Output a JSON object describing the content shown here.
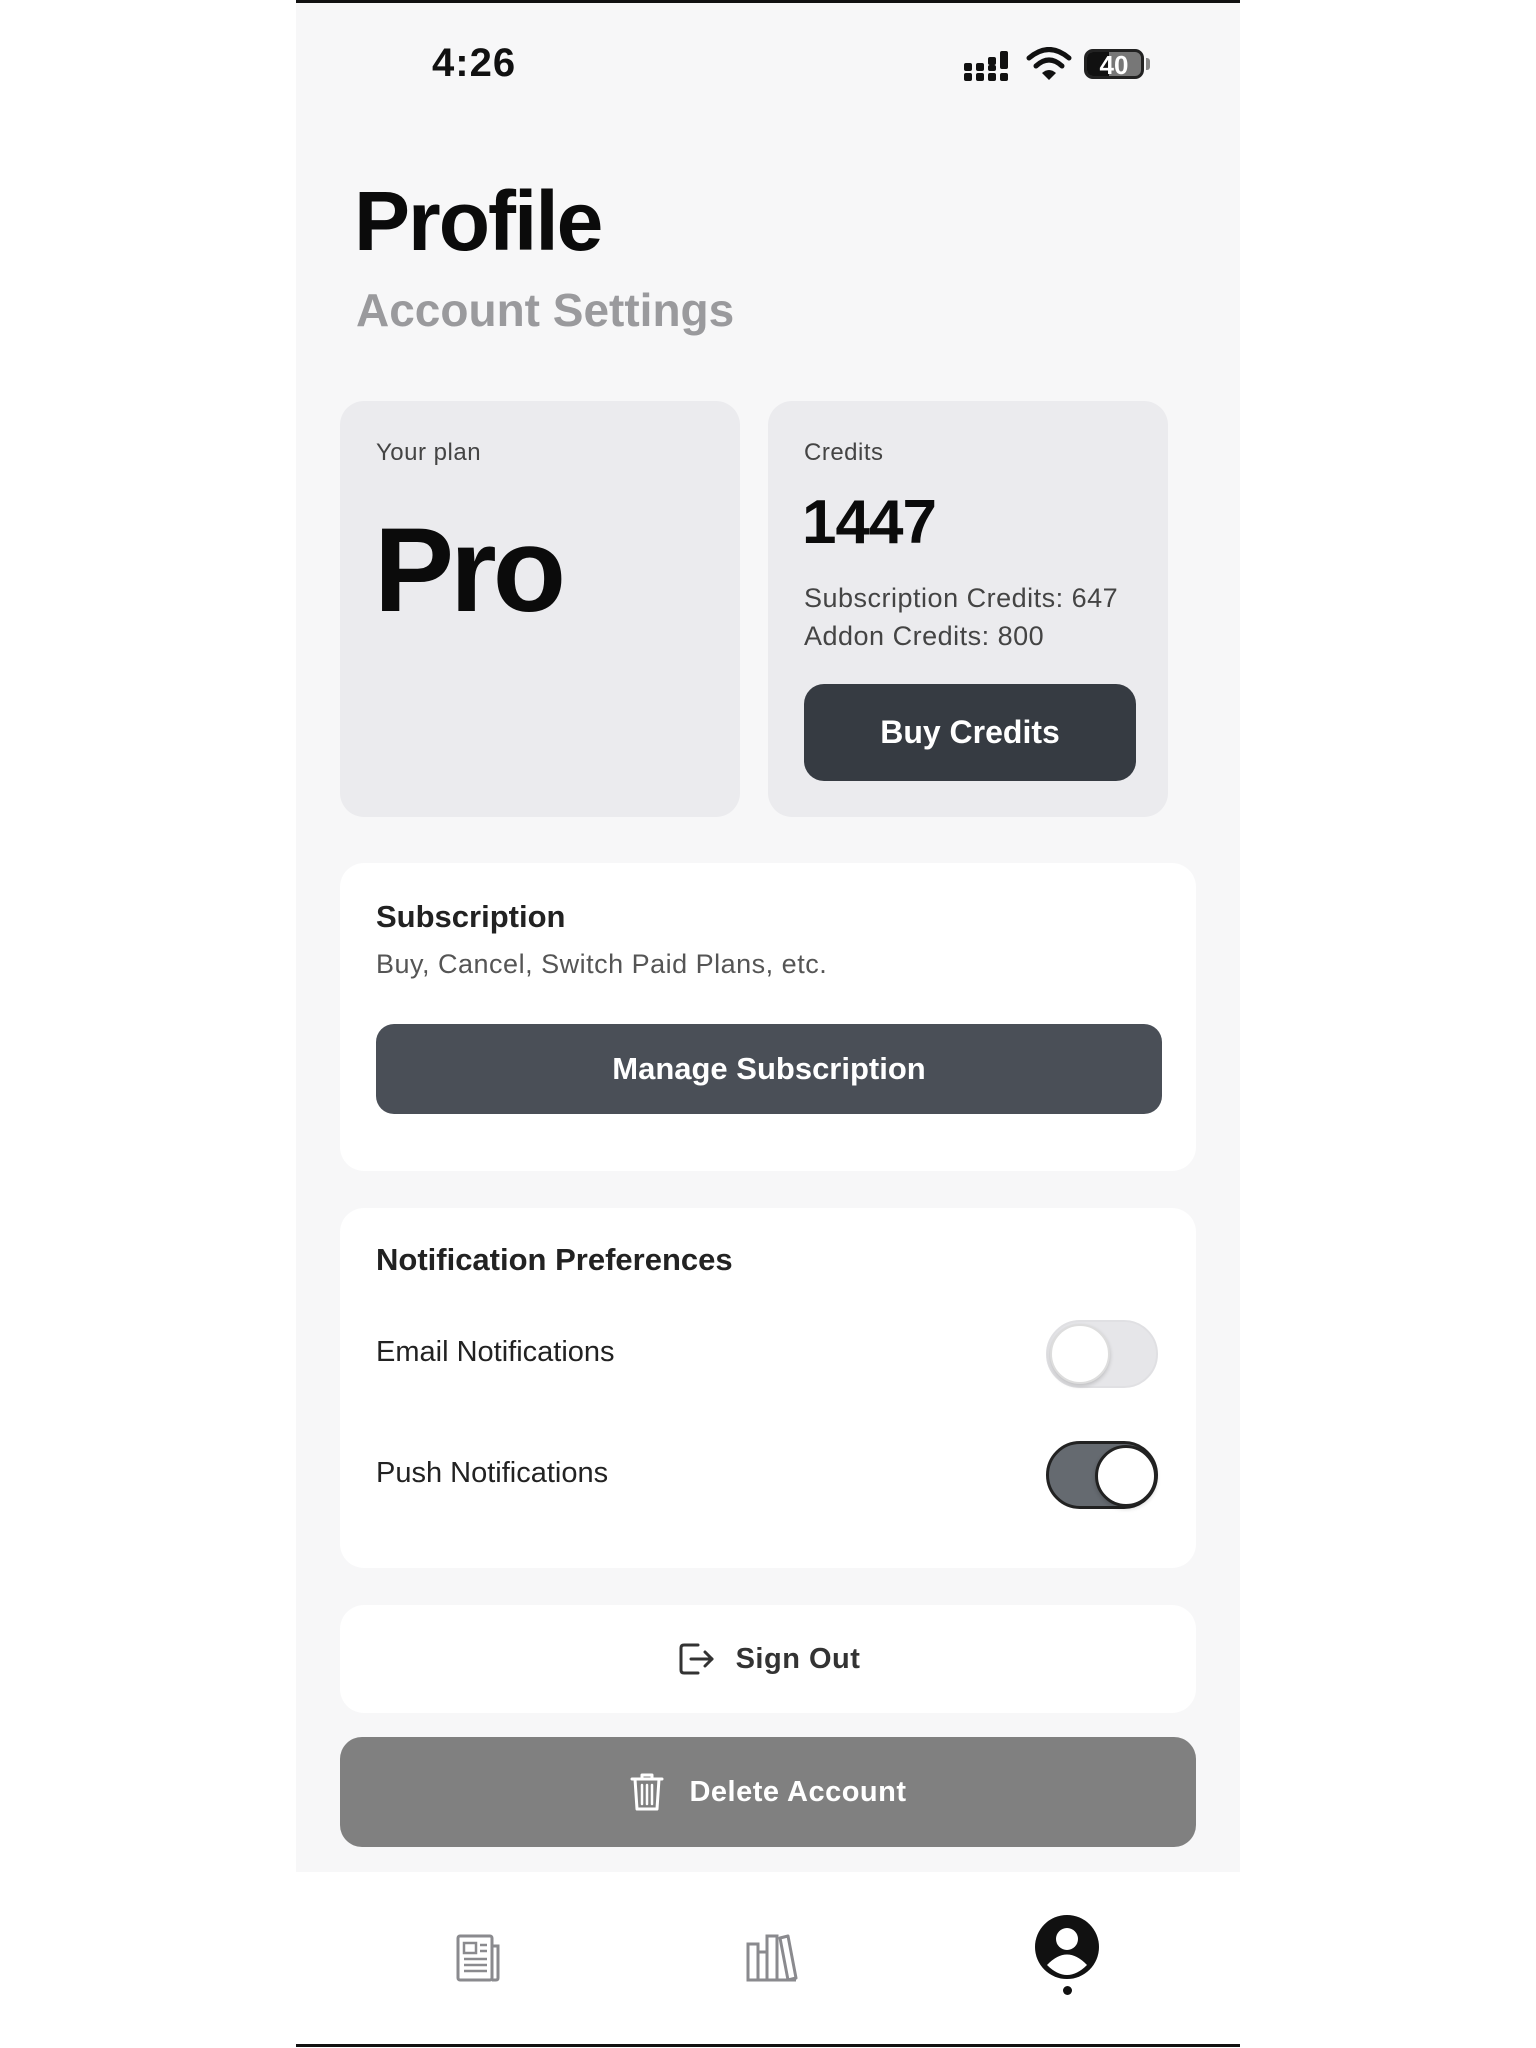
{
  "status_bar": {
    "time": "4:26",
    "battery": "40",
    "icons": [
      "signal-icon",
      "wifi-icon",
      "battery-icon"
    ]
  },
  "header": {
    "title": "Profile",
    "subtitle": "Account Settings"
  },
  "plan_card": {
    "label": "Your plan",
    "plan_name": "Pro"
  },
  "credits_card": {
    "label": "Credits",
    "total": "1447",
    "subscription_credits": "Subscription Credits: 647",
    "addon_credits": "Addon Credits: 800",
    "buy_label": "Buy Credits"
  },
  "subscription": {
    "title": "Subscription",
    "description": "Buy, Cancel, Switch Paid Plans, etc.",
    "manage_label": "Manage Subscription"
  },
  "notifications": {
    "title": "Notification Preferences",
    "email": {
      "label": "Email Notifications",
      "enabled": false
    },
    "push": {
      "label": "Push Notifications",
      "enabled": true
    }
  },
  "account_actions": {
    "sign_out_label": "Sign Out",
    "delete_label": "Delete Account"
  },
  "tab_bar": {
    "tabs": [
      {
        "icon": "news-icon",
        "active": false
      },
      {
        "icon": "library-icon",
        "active": false
      },
      {
        "icon": "profile-icon",
        "active": true
      }
    ]
  },
  "colors": {
    "background": "#f7f7f8",
    "card": "#ebebee",
    "dark_button": "#363b42",
    "manage_button": "#4a4f57",
    "delete_button": "#808080",
    "toggle_on": "#656a70"
  }
}
